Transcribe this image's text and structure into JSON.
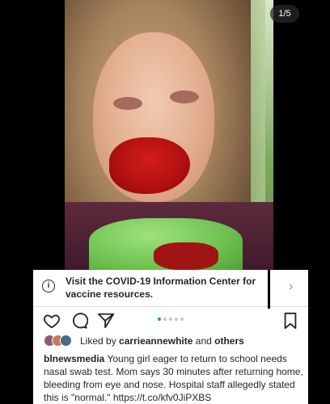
{
  "post": {
    "image_counter": "1/5",
    "info_banner": {
      "text": "Visit the COVID-19 Information Center for vaccine resources.",
      "icon": "info-icon",
      "chevron": "›"
    },
    "actions": {
      "like_icon": "heart-icon",
      "comment_icon": "comment-icon",
      "share_icon": "send-icon",
      "save_icon": "bookmark-icon",
      "carousel_total": 5,
      "carousel_active_index": 1
    },
    "likes": {
      "prefix": "Liked by",
      "user": "carrieannewhite",
      "connector": "and",
      "others": "others"
    },
    "caption": {
      "username": "blnewsmedia",
      "text": "Young girl eager to return to school needs nasal swab test. Mom says 30 minutes after returning home, bleeding from eye and nose. Hospital staff allegedly stated this is \"normal.\" https://t.co/kfv0JiPXBS"
    },
    "colors": {
      "accent": "#0095f6",
      "text": "#262626",
      "muted": "#8e8e8e"
    }
  }
}
